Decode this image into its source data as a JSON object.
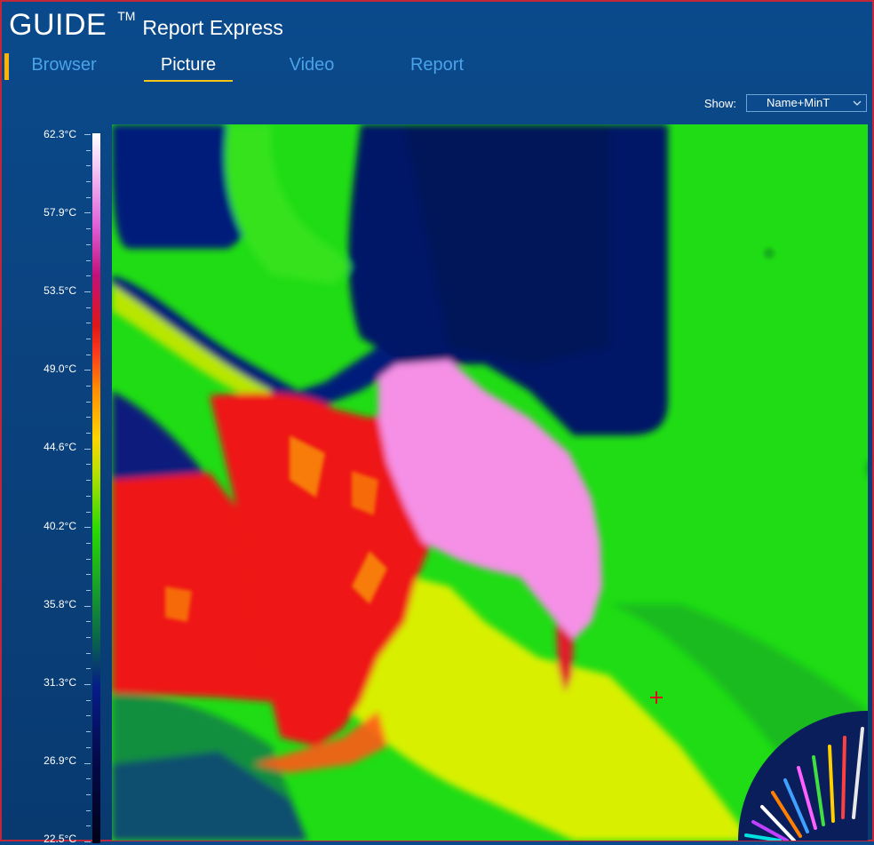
{
  "app": {
    "brand": "GUIDE",
    "trademark": "TM",
    "product": "Report Express"
  },
  "tabs": [
    {
      "label": "Browser",
      "active": false
    },
    {
      "label": "Picture",
      "active": true
    },
    {
      "label": "Video",
      "active": false
    },
    {
      "label": "Report",
      "active": false
    }
  ],
  "show": {
    "label": "Show:",
    "value": "Name+MinT"
  },
  "scale": {
    "labels": [
      "62.3°C",
      "57.9°C",
      "53.5°C",
      "49.0°C",
      "44.6°C",
      "40.2°C",
      "35.8°C",
      "31.3°C",
      "26.9°C",
      "22.5°C"
    ],
    "max": 62.3,
    "min": 22.5
  },
  "colors": {
    "accent": "#f5c518",
    "tab_inactive": "#4aa3e8",
    "background": "#0b437f",
    "border": "#c0283a"
  },
  "icons": {
    "dropdown": "chevron-down-icon",
    "crosshair": "crosshair-icon",
    "palette": "palette-wheel-icon"
  }
}
